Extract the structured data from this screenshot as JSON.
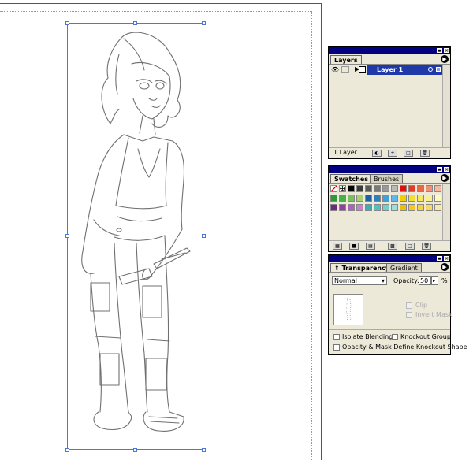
{
  "layers_panel": {
    "tab_label": "Layers",
    "layer_name": "Layer 1",
    "layer_count": "1 Layer"
  },
  "swatches_panel": {
    "tabs": [
      "Swatches",
      "Brushes"
    ],
    "swatch_colors": [
      [
        "#ffffff",
        "#ffffff",
        "#000000",
        "#3a3a3a",
        "#5a5a5a",
        "#7a7a7a",
        "#9a9a9a",
        "#bababa",
        "#e01010",
        "#e03c2c",
        "#e86848",
        "#f09078",
        "#f8b8a0"
      ],
      [
        "#2c9a3c",
        "#48b048",
        "#78c060",
        "#a8d070",
        "#2060a0",
        "#3080c0",
        "#40a0d8",
        "#60b8e8",
        "#f0d000",
        "#f0e030",
        "#f8e860",
        "#f8f090",
        "#fff8c0"
      ],
      [
        "#702880",
        "#9040a0",
        "#b060c0",
        "#c880d0",
        "#3ab0b0",
        "#50c0c0",
        "#70d0d0",
        "#98e0e0",
        "#f0c000",
        "#f4c820",
        "#f8d040",
        "#f8d860",
        "#fce8a0"
      ]
    ]
  },
  "transparency_panel": {
    "tabs": [
      "Transparency",
      "Gradient"
    ],
    "blend_mode": "Normal",
    "opacity_label": "Opacity:",
    "opacity_value": "50",
    "percent": "%",
    "clip_label": "Clip",
    "invert_mask_label": "Invert Mask",
    "isolate_blending_label": "Isolate Blending",
    "knockout_group_label": "Knockout Group",
    "opacity_mask_label": "Opacity & Mask Define Knockout Shape"
  },
  "colors": {
    "selection": "#4a78d8",
    "titlebar": "#000080",
    "layer_selected": "#1f3aa8",
    "panel_bg": "#ece9d8"
  }
}
